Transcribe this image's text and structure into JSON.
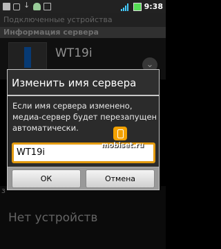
{
  "status_bar": {
    "time": "9:38"
  },
  "background_screen": {
    "title": "Подключенные устройства",
    "section_header": "Информация сервера",
    "server_name": "WT19i",
    "lower_letter": "з",
    "no_devices": "Нет устройств"
  },
  "dialog": {
    "title": "Изменить имя сервера",
    "message": "Если имя сервера изменено, медиа-сервер будет перезапущен автоматически.",
    "input_value": "WT19i",
    "ok_label": "ОК",
    "cancel_label": "Отмена"
  },
  "watermark": {
    "text": "mobiset.ru"
  }
}
